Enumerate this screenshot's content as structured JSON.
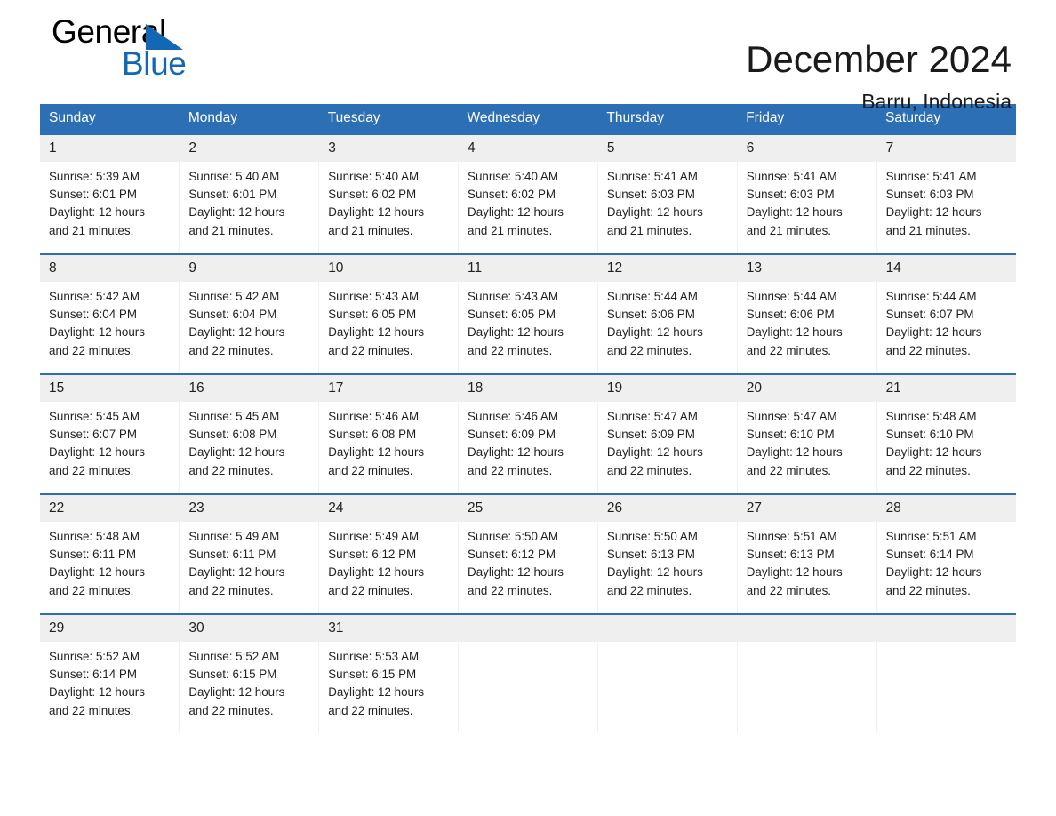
{
  "brand": {
    "line1": "General",
    "line2": "Blue",
    "triangle_color": "#1268b3",
    "text_color": "#000000"
  },
  "header": {
    "title": "December 2024",
    "subtitle": "Barru, Indonesia"
  },
  "theme": {
    "header_blue": "#2d6fb5",
    "daynum_gray": "#efefef",
    "text": "#231f20"
  },
  "calendar": {
    "weekday_headers": [
      "Sunday",
      "Monday",
      "Tuesday",
      "Wednesday",
      "Thursday",
      "Friday",
      "Saturday"
    ],
    "labels": {
      "sunrise": "Sunrise:",
      "sunset": "Sunset:",
      "daylight": "Daylight:"
    },
    "weeks": [
      [
        {
          "day": "1",
          "sunrise": "Sunrise: 5:39 AM",
          "sunset": "Sunset: 6:01 PM",
          "daylight1": "Daylight: 12 hours",
          "daylight2": "and 21 minutes."
        },
        {
          "day": "2",
          "sunrise": "Sunrise: 5:40 AM",
          "sunset": "Sunset: 6:01 PM",
          "daylight1": "Daylight: 12 hours",
          "daylight2": "and 21 minutes."
        },
        {
          "day": "3",
          "sunrise": "Sunrise: 5:40 AM",
          "sunset": "Sunset: 6:02 PM",
          "daylight1": "Daylight: 12 hours",
          "daylight2": "and 21 minutes."
        },
        {
          "day": "4",
          "sunrise": "Sunrise: 5:40 AM",
          "sunset": "Sunset: 6:02 PM",
          "daylight1": "Daylight: 12 hours",
          "daylight2": "and 21 minutes."
        },
        {
          "day": "5",
          "sunrise": "Sunrise: 5:41 AM",
          "sunset": "Sunset: 6:03 PM",
          "daylight1": "Daylight: 12 hours",
          "daylight2": "and 21 minutes."
        },
        {
          "day": "6",
          "sunrise": "Sunrise: 5:41 AM",
          "sunset": "Sunset: 6:03 PM",
          "daylight1": "Daylight: 12 hours",
          "daylight2": "and 21 minutes."
        },
        {
          "day": "7",
          "sunrise": "Sunrise: 5:41 AM",
          "sunset": "Sunset: 6:03 PM",
          "daylight1": "Daylight: 12 hours",
          "daylight2": "and 21 minutes."
        }
      ],
      [
        {
          "day": "8",
          "sunrise": "Sunrise: 5:42 AM",
          "sunset": "Sunset: 6:04 PM",
          "daylight1": "Daylight: 12 hours",
          "daylight2": "and 22 minutes."
        },
        {
          "day": "9",
          "sunrise": "Sunrise: 5:42 AM",
          "sunset": "Sunset: 6:04 PM",
          "daylight1": "Daylight: 12 hours",
          "daylight2": "and 22 minutes."
        },
        {
          "day": "10",
          "sunrise": "Sunrise: 5:43 AM",
          "sunset": "Sunset: 6:05 PM",
          "daylight1": "Daylight: 12 hours",
          "daylight2": "and 22 minutes."
        },
        {
          "day": "11",
          "sunrise": "Sunrise: 5:43 AM",
          "sunset": "Sunset: 6:05 PM",
          "daylight1": "Daylight: 12 hours",
          "daylight2": "and 22 minutes."
        },
        {
          "day": "12",
          "sunrise": "Sunrise: 5:44 AM",
          "sunset": "Sunset: 6:06 PM",
          "daylight1": "Daylight: 12 hours",
          "daylight2": "and 22 minutes."
        },
        {
          "day": "13",
          "sunrise": "Sunrise: 5:44 AM",
          "sunset": "Sunset: 6:06 PM",
          "daylight1": "Daylight: 12 hours",
          "daylight2": "and 22 minutes."
        },
        {
          "day": "14",
          "sunrise": "Sunrise: 5:44 AM",
          "sunset": "Sunset: 6:07 PM",
          "daylight1": "Daylight: 12 hours",
          "daylight2": "and 22 minutes."
        }
      ],
      [
        {
          "day": "15",
          "sunrise": "Sunrise: 5:45 AM",
          "sunset": "Sunset: 6:07 PM",
          "daylight1": "Daylight: 12 hours",
          "daylight2": "and 22 minutes."
        },
        {
          "day": "16",
          "sunrise": "Sunrise: 5:45 AM",
          "sunset": "Sunset: 6:08 PM",
          "daylight1": "Daylight: 12 hours",
          "daylight2": "and 22 minutes."
        },
        {
          "day": "17",
          "sunrise": "Sunrise: 5:46 AM",
          "sunset": "Sunset: 6:08 PM",
          "daylight1": "Daylight: 12 hours",
          "daylight2": "and 22 minutes."
        },
        {
          "day": "18",
          "sunrise": "Sunrise: 5:46 AM",
          "sunset": "Sunset: 6:09 PM",
          "daylight1": "Daylight: 12 hours",
          "daylight2": "and 22 minutes."
        },
        {
          "day": "19",
          "sunrise": "Sunrise: 5:47 AM",
          "sunset": "Sunset: 6:09 PM",
          "daylight1": "Daylight: 12 hours",
          "daylight2": "and 22 minutes."
        },
        {
          "day": "20",
          "sunrise": "Sunrise: 5:47 AM",
          "sunset": "Sunset: 6:10 PM",
          "daylight1": "Daylight: 12 hours",
          "daylight2": "and 22 minutes."
        },
        {
          "day": "21",
          "sunrise": "Sunrise: 5:48 AM",
          "sunset": "Sunset: 6:10 PM",
          "daylight1": "Daylight: 12 hours",
          "daylight2": "and 22 minutes."
        }
      ],
      [
        {
          "day": "22",
          "sunrise": "Sunrise: 5:48 AM",
          "sunset": "Sunset: 6:11 PM",
          "daylight1": "Daylight: 12 hours",
          "daylight2": "and 22 minutes."
        },
        {
          "day": "23",
          "sunrise": "Sunrise: 5:49 AM",
          "sunset": "Sunset: 6:11 PM",
          "daylight1": "Daylight: 12 hours",
          "daylight2": "and 22 minutes."
        },
        {
          "day": "24",
          "sunrise": "Sunrise: 5:49 AM",
          "sunset": "Sunset: 6:12 PM",
          "daylight1": "Daylight: 12 hours",
          "daylight2": "and 22 minutes."
        },
        {
          "day": "25",
          "sunrise": "Sunrise: 5:50 AM",
          "sunset": "Sunset: 6:12 PM",
          "daylight1": "Daylight: 12 hours",
          "daylight2": "and 22 minutes."
        },
        {
          "day": "26",
          "sunrise": "Sunrise: 5:50 AM",
          "sunset": "Sunset: 6:13 PM",
          "daylight1": "Daylight: 12 hours",
          "daylight2": "and 22 minutes."
        },
        {
          "day": "27",
          "sunrise": "Sunrise: 5:51 AM",
          "sunset": "Sunset: 6:13 PM",
          "daylight1": "Daylight: 12 hours",
          "daylight2": "and 22 minutes."
        },
        {
          "day": "28",
          "sunrise": "Sunrise: 5:51 AM",
          "sunset": "Sunset: 6:14 PM",
          "daylight1": "Daylight: 12 hours",
          "daylight2": "and 22 minutes."
        }
      ],
      [
        {
          "day": "29",
          "sunrise": "Sunrise: 5:52 AM",
          "sunset": "Sunset: 6:14 PM",
          "daylight1": "Daylight: 12 hours",
          "daylight2": "and 22 minutes."
        },
        {
          "day": "30",
          "sunrise": "Sunrise: 5:52 AM",
          "sunset": "Sunset: 6:15 PM",
          "daylight1": "Daylight: 12 hours",
          "daylight2": "and 22 minutes."
        },
        {
          "day": "31",
          "sunrise": "Sunrise: 5:53 AM",
          "sunset": "Sunset: 6:15 PM",
          "daylight1": "Daylight: 12 hours",
          "daylight2": "and 22 minutes."
        },
        {
          "day": "",
          "sunrise": "",
          "sunset": "",
          "daylight1": "",
          "daylight2": ""
        },
        {
          "day": "",
          "sunrise": "",
          "sunset": "",
          "daylight1": "",
          "daylight2": ""
        },
        {
          "day": "",
          "sunrise": "",
          "sunset": "",
          "daylight1": "",
          "daylight2": ""
        },
        {
          "day": "",
          "sunrise": "",
          "sunset": "",
          "daylight1": "",
          "daylight2": ""
        }
      ]
    ]
  }
}
